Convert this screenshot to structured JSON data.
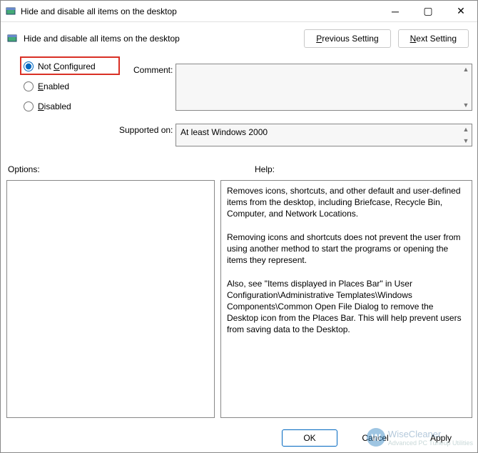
{
  "window": {
    "title": "Hide and disable all items on the desktop",
    "header_title": "Hide and disable all items on the desktop"
  },
  "nav": {
    "previous": "Previous Setting",
    "next": "Next Setting"
  },
  "state": {
    "not_configured": "Not Configured",
    "enabled": "Enabled",
    "disabled": "Disabled",
    "selected": "not_configured"
  },
  "labels": {
    "comment": "Comment:",
    "supported": "Supported on:",
    "options": "Options:",
    "help": "Help:"
  },
  "comment": "",
  "supported_text": "At least Windows 2000",
  "help_text": "Removes icons, shortcuts, and other default and user-defined items from the desktop, including Briefcase, Recycle Bin, Computer, and Network Locations.\n\nRemoving icons and shortcuts does not prevent the user from using another method to start the programs or opening the items they represent.\n\nAlso, see \"Items displayed in Places Bar\" in User Configuration\\Administrative Templates\\Windows Components\\Common Open File Dialog to remove the Desktop icon from the Places Bar. This will help prevent users from saving data to the Desktop.",
  "buttons": {
    "ok": "OK",
    "cancel": "Cancel",
    "apply": "Apply"
  },
  "watermark": {
    "brand": "WiseCleaner",
    "tag": "Advanced PC Tuneup Utilities"
  }
}
